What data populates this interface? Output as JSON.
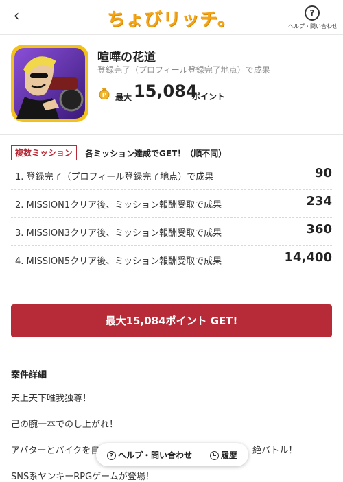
{
  "header": {
    "back_icon": "‹",
    "logo": "ちょびリッチ。",
    "help_icon": "?",
    "help_label": "ヘルプ・問い合わせ"
  },
  "offer": {
    "title": "喧嘩の花道",
    "subtitle": "登録完了（プロフィール登録完了地点）で成果",
    "max_label": "最大",
    "max_points": "15,084",
    "points_label": "ポイント"
  },
  "missions": {
    "tag": "複数ミッション",
    "note": "各ミッション達成でGET！（順不同）",
    "items": [
      {
        "label": "1. 登録完了（プロフィール登録完了地点）で成果",
        "points": "90"
      },
      {
        "label": "2. MISSION1クリア後、ミッション報酬受取で成果",
        "points": "234"
      },
      {
        "label": "3. MISSION3クリア後、ミッション報酬受取で成果",
        "points": "360"
      },
      {
        "label": "4. MISSION5クリア後、ミッション報酬受取で成果",
        "points": "14,400"
      }
    ]
  },
  "cta": {
    "label": "最大15,084ポイント GET!"
  },
  "details": {
    "title": "案件詳細",
    "lines": [
      "天上天下唯我独尊！",
      "己の腕一本でのし上がれ！",
      "アバターとバイクを自",
      "絶バトル！",
      "SNS系ヤンキーRPGゲームが登場！"
    ]
  },
  "floating_bar": {
    "help_label": "ヘルプ・問い合わせ",
    "history_label": "履歴"
  },
  "colors": {
    "accent": "#b62b37",
    "logo": "#f2a51a"
  }
}
